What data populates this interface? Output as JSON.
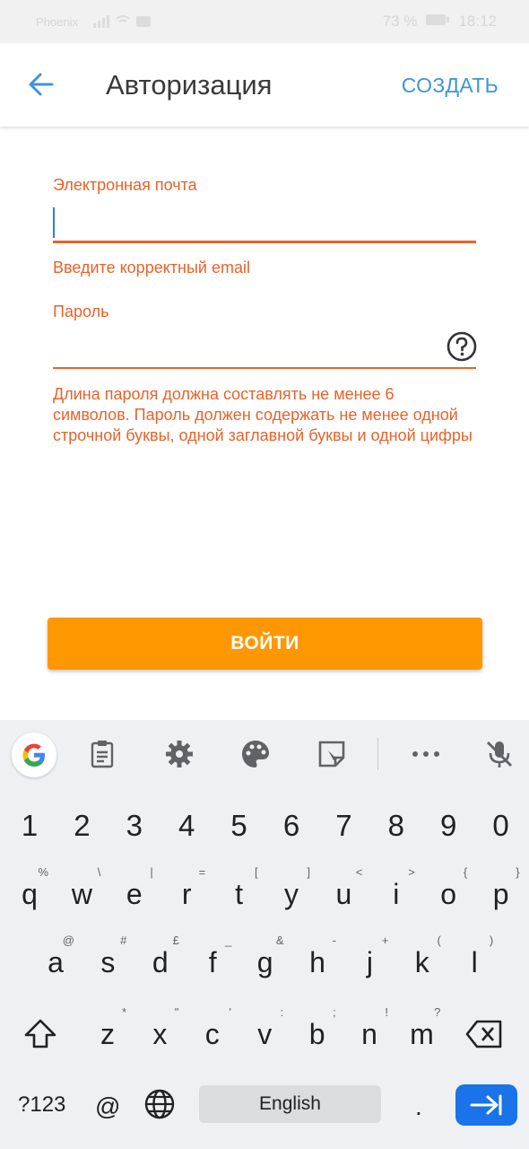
{
  "status_bar": {
    "carrier": "Phoenix",
    "battery": "73 %",
    "time": "18:12"
  },
  "app_bar": {
    "back_icon": "arrow-left-icon",
    "title": "Авторизация",
    "create_label": "СОЗДАТЬ"
  },
  "form": {
    "email_label": "Электронная почта",
    "email_value": "",
    "email_error": "Введите корректный email",
    "password_label": "Пароль",
    "password_value": "",
    "password_error": "Длина пароля должна составлять не менее 6 символов. Пароль должен содержать не менее одной строчной буквы, одной заглавной буквы и одной цифры",
    "help_icon": "question-circle-icon"
  },
  "login_button": "ВОЙТИ",
  "colors": {
    "accent": "#3f95d9",
    "error": "#e8622a",
    "button": "#ff9800",
    "enter": "#1a73e8"
  },
  "keyboard": {
    "toolbar": [
      "google-icon",
      "clipboard-icon",
      "gear-icon",
      "palette-icon",
      "sticker-icon",
      "more-icon",
      "mic-off-icon"
    ],
    "numbers": [
      "1",
      "2",
      "3",
      "4",
      "5",
      "6",
      "7",
      "8",
      "9",
      "0"
    ],
    "row1": [
      {
        "k": "q",
        "h": "%"
      },
      {
        "k": "w",
        "h": "\\"
      },
      {
        "k": "e",
        "h": "|"
      },
      {
        "k": "r",
        "h": "="
      },
      {
        "k": "t",
        "h": "["
      },
      {
        "k": "y",
        "h": "]"
      },
      {
        "k": "u",
        "h": "<"
      },
      {
        "k": "i",
        "h": ">"
      },
      {
        "k": "o",
        "h": "{"
      },
      {
        "k": "p",
        "h": "}"
      }
    ],
    "row2": [
      {
        "k": "a",
        "h": "@"
      },
      {
        "k": "s",
        "h": "#"
      },
      {
        "k": "d",
        "h": "£"
      },
      {
        "k": "f",
        "h": "_"
      },
      {
        "k": "g",
        "h": "&"
      },
      {
        "k": "h",
        "h": "-"
      },
      {
        "k": "j",
        "h": "+"
      },
      {
        "k": "k",
        "h": "("
      },
      {
        "k": "l",
        "h": ")"
      }
    ],
    "row3": [
      {
        "k": "z",
        "h": "*"
      },
      {
        "k": "x",
        "h": "\""
      },
      {
        "k": "c",
        "h": "'"
      },
      {
        "k": "v",
        "h": ":"
      },
      {
        "k": "b",
        "h": ";"
      },
      {
        "k": "n",
        "h": "!"
      },
      {
        "k": "m",
        "h": "?"
      }
    ],
    "symbols_key": "?123",
    "at_key": "@",
    "space_label": "English",
    "period_key": "."
  }
}
